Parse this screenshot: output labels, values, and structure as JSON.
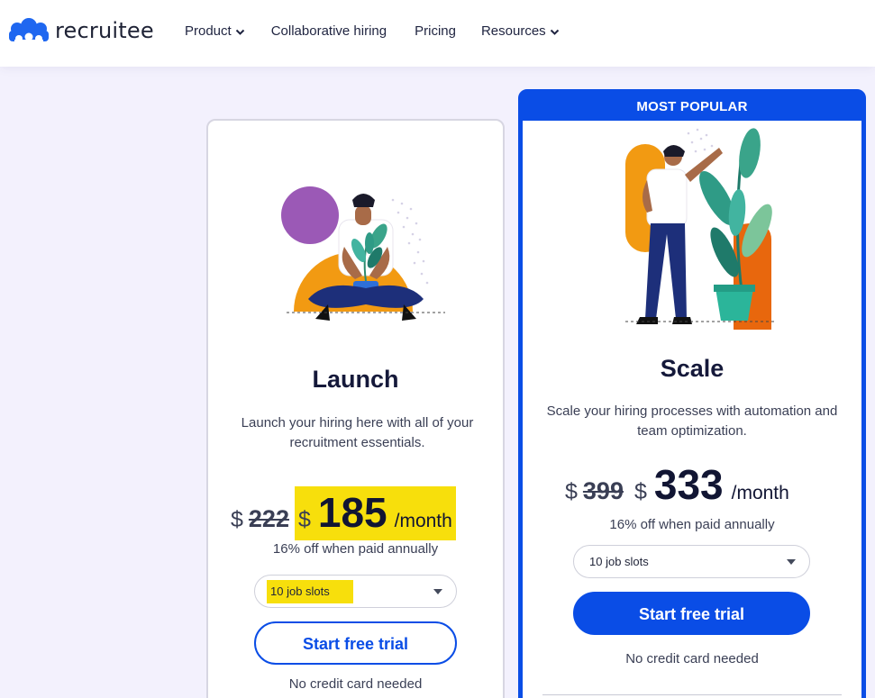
{
  "brand": {
    "name": "recruitee",
    "logo_color": "#1f67f0"
  },
  "nav": {
    "items": [
      {
        "label": "Product",
        "has_dropdown": true
      },
      {
        "label": "Collaborative hiring",
        "has_dropdown": false
      },
      {
        "label": "Pricing",
        "has_dropdown": false
      },
      {
        "label": "Resources",
        "has_dropdown": true
      }
    ]
  },
  "plans": [
    {
      "title": "Launch",
      "description": "Launch your hiring here with all of your recruitment essentials.",
      "currency": "$",
      "old_price": "222",
      "price": "185",
      "period": "/month",
      "annual_note": "16% off when paid annually",
      "job_slots": {
        "selected": "10 job slots"
      },
      "cta": "Start free trial",
      "cta_style": "outline",
      "footnote": "No credit card needed"
    },
    {
      "badge": "MOST POPULAR",
      "title": "Scale",
      "description": "Scale your hiring processes with automation and team optimization.",
      "currency": "$",
      "old_price": "399",
      "price": "333",
      "period": "/month",
      "annual_note": "16% off when paid annually",
      "job_slots": {
        "selected": "10 job slots"
      },
      "cta": "Start free trial",
      "cta_style": "solid",
      "footnote": "No credit card needed"
    }
  ],
  "colors": {
    "primary": "#0a4de6",
    "highlight": "#f7df0c",
    "background": "#f3f1fd",
    "text_dark": "#15193a"
  }
}
